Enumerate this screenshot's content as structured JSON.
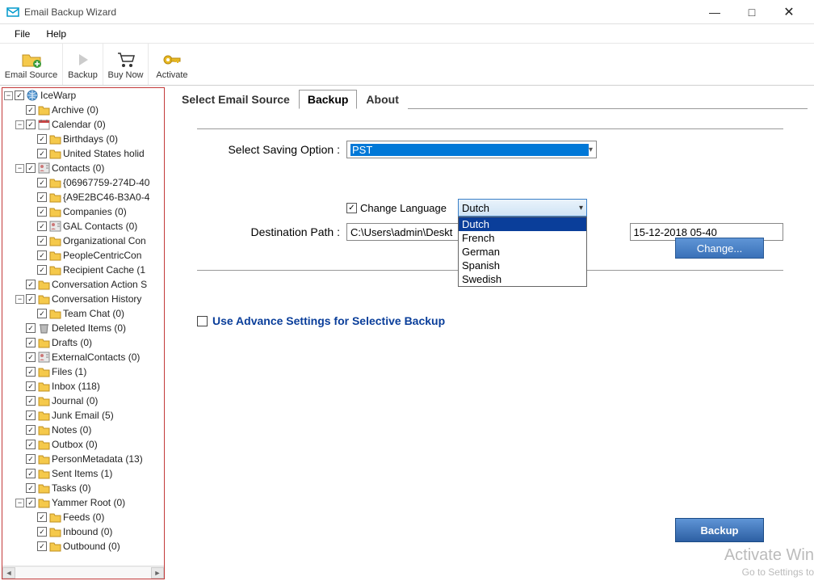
{
  "window": {
    "title": "Email Backup Wizard"
  },
  "menu": {
    "file": "File",
    "help": "Help"
  },
  "toolbar": {
    "email_source": "Email Source",
    "backup": "Backup",
    "buy_now": "Buy Now",
    "activate": "Activate"
  },
  "tree": [
    {
      "level": 0,
      "icon": "globe",
      "label": "IceWarp",
      "expander": "-"
    },
    {
      "level": 1,
      "icon": "folder",
      "label": "Archive (0)"
    },
    {
      "level": 1,
      "icon": "calendar",
      "label": "Calendar (0)",
      "expander": "-"
    },
    {
      "level": 2,
      "icon": "folder",
      "label": "Birthdays (0)"
    },
    {
      "level": 2,
      "icon": "folder",
      "label": "United States holid"
    },
    {
      "level": 1,
      "icon": "contacts",
      "label": "Contacts (0)",
      "expander": "-"
    },
    {
      "level": 2,
      "icon": "folder",
      "label": "{06967759-274D-40"
    },
    {
      "level": 2,
      "icon": "folder",
      "label": "{A9E2BC46-B3A0-4"
    },
    {
      "level": 2,
      "icon": "folder",
      "label": "Companies (0)"
    },
    {
      "level": 2,
      "icon": "contacts",
      "label": "GAL Contacts (0)"
    },
    {
      "level": 2,
      "icon": "folder",
      "label": "Organizational Con"
    },
    {
      "level": 2,
      "icon": "folder",
      "label": "PeopleCentricCon"
    },
    {
      "level": 2,
      "icon": "folder",
      "label": "Recipient Cache (1"
    },
    {
      "level": 1,
      "icon": "folder",
      "label": "Conversation Action S"
    },
    {
      "level": 1,
      "icon": "folder",
      "label": "Conversation History",
      "expander": "-"
    },
    {
      "level": 2,
      "icon": "folder",
      "label": "Team Chat (0)"
    },
    {
      "level": 1,
      "icon": "trash",
      "label": "Deleted Items (0)"
    },
    {
      "level": 1,
      "icon": "folder",
      "label": "Drafts (0)"
    },
    {
      "level": 1,
      "icon": "contacts",
      "label": "ExternalContacts (0)"
    },
    {
      "level": 1,
      "icon": "folder",
      "label": "Files (1)"
    },
    {
      "level": 1,
      "icon": "folder",
      "label": "Inbox (118)"
    },
    {
      "level": 1,
      "icon": "folder",
      "label": "Journal (0)"
    },
    {
      "level": 1,
      "icon": "folder",
      "label": "Junk Email (5)"
    },
    {
      "level": 1,
      "icon": "folder",
      "label": "Notes (0)"
    },
    {
      "level": 1,
      "icon": "folder",
      "label": "Outbox (0)"
    },
    {
      "level": 1,
      "icon": "folder",
      "label": "PersonMetadata (13)"
    },
    {
      "level": 1,
      "icon": "folder",
      "label": "Sent Items (1)"
    },
    {
      "level": 1,
      "icon": "folder",
      "label": "Tasks (0)"
    },
    {
      "level": 1,
      "icon": "folder",
      "label": "Yammer Root (0)",
      "expander": "-"
    },
    {
      "level": 2,
      "icon": "folder",
      "label": "Feeds (0)"
    },
    {
      "level": 2,
      "icon": "folder",
      "label": "Inbound (0)"
    },
    {
      "level": 2,
      "icon": "folder",
      "label": "Outbound (0)"
    }
  ],
  "tabs": {
    "source": "Select Email Source",
    "backup": "Backup",
    "about": "About"
  },
  "form": {
    "saving_label": "Select Saving Option :",
    "saving_value": "PST",
    "change_lang_label": "Change Language",
    "lang_value": "Dutch",
    "lang_options": [
      "Dutch",
      "French",
      "German",
      "Spanish",
      "Swedish"
    ],
    "dest_label": "Destination Path :",
    "dest_value_left": "C:\\Users\\admin\\Deskt",
    "dest_value_right": "15-12-2018 05-40",
    "change_btn": "Change...",
    "adv_label": "Use Advance Settings for Selective Backup",
    "backup_btn": "Backup"
  },
  "watermark": {
    "title": "Activate Win",
    "sub": "Go to Settings to"
  }
}
